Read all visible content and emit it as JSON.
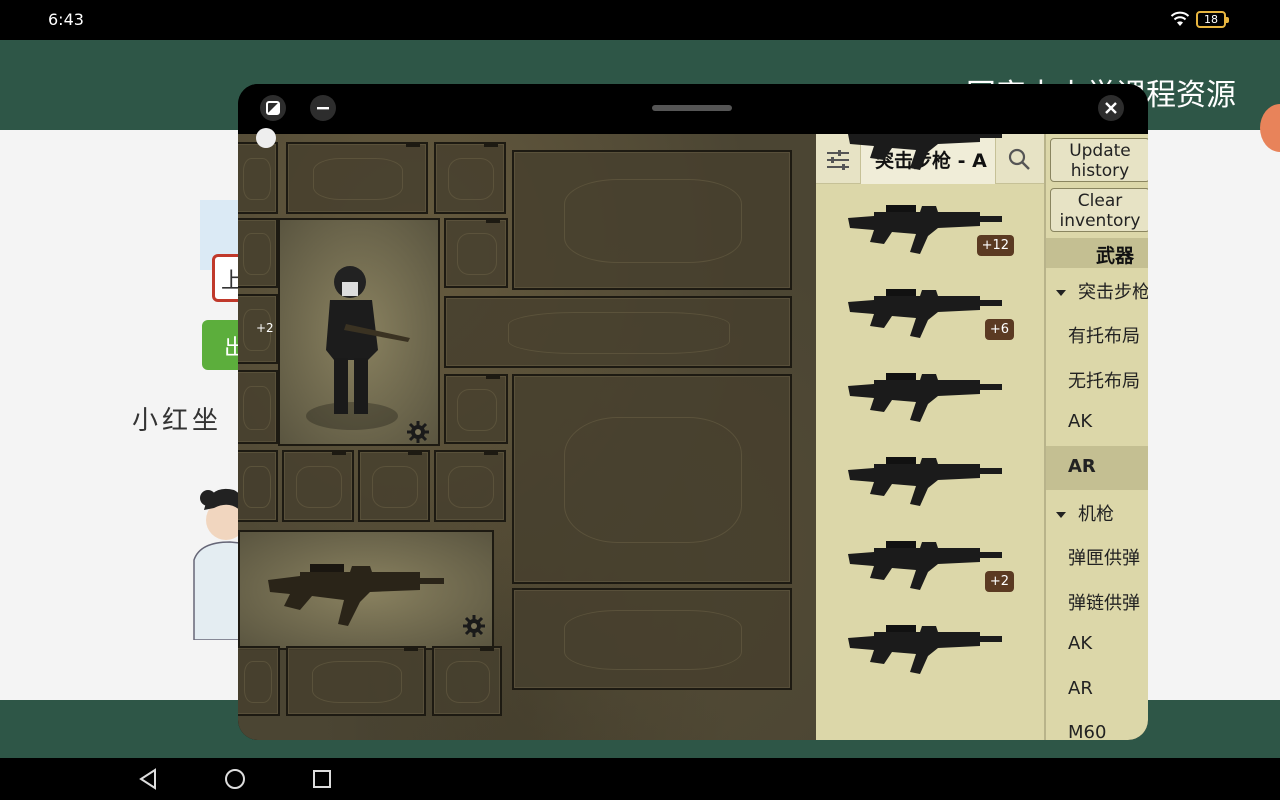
{
  "status_bar": {
    "time": "6:43",
    "battery": "18"
  },
  "background_app": {
    "header_title": "国家中小学课程资源",
    "red_box_char": "上",
    "green_button_char": "出",
    "caption": "小红坐"
  },
  "window": {
    "left_badge": "+2"
  },
  "list_panel": {
    "search_value": "突击步枪 - A",
    "items": [
      {
        "name": "rifle-1",
        "badge": ""
      },
      {
        "name": "rifle-2",
        "badge": "+12"
      },
      {
        "name": "rifle-3",
        "badge": "+6"
      },
      {
        "name": "rifle-4",
        "badge": ""
      },
      {
        "name": "rifle-5",
        "badge": ""
      },
      {
        "name": "rifle-6",
        "badge": "+2"
      },
      {
        "name": "rifle-7",
        "badge": ""
      }
    ]
  },
  "category_panel": {
    "update_history": "Update history",
    "clear_inventory": "Clear inventory",
    "heading": "武器",
    "items": [
      {
        "label": "突击步枪",
        "group": true,
        "selected": false
      },
      {
        "label": "有托布局",
        "group": false,
        "selected": false
      },
      {
        "label": "无托布局",
        "group": false,
        "selected": false
      },
      {
        "label": "AK",
        "group": false,
        "selected": false
      },
      {
        "label": "AR",
        "group": false,
        "selected": true
      },
      {
        "label": "机枪",
        "group": true,
        "selected": false
      },
      {
        "label": "弹匣供弹",
        "group": false,
        "selected": false
      },
      {
        "label": "弹链供弹",
        "group": false,
        "selected": false
      },
      {
        "label": "AK",
        "group": false,
        "selected": false
      },
      {
        "label": "AR",
        "group": false,
        "selected": false
      },
      {
        "label": "M60",
        "group": false,
        "selected": false
      }
    ]
  },
  "colors": {
    "header_green": "#2e5647",
    "panel_tan": "#dcd7a9",
    "badge_brown": "#5b3a22"
  }
}
